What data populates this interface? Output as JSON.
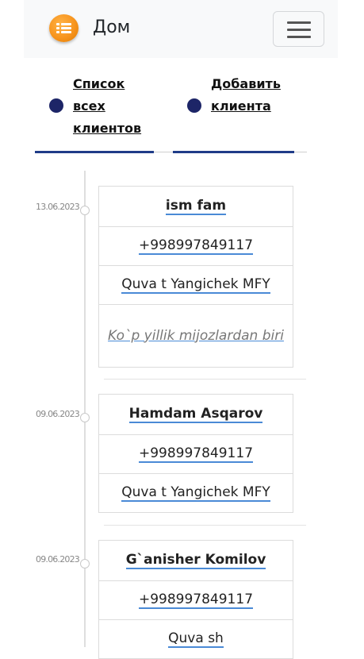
{
  "navbar": {
    "brand_icon": "list-icon",
    "title": "Дом",
    "toggler_icon": "hamburger-icon",
    "accent": "#f7941d"
  },
  "tabs": [
    {
      "label": "Список\nвсех\nклиентов",
      "active": true
    },
    {
      "label": "Добавить\nклиента",
      "active": true
    }
  ],
  "colors": {
    "tab_accent": "#1f3c88",
    "dot": "#1d2567",
    "link_underline": "#4a8ad6"
  },
  "clients": [
    {
      "date": "13.06.2023",
      "name": "ism fam",
      "phone": "+998997849117",
      "address": "Quva t Yangichek MFY",
      "note": "Ko`p yillik mijozlardan biri"
    },
    {
      "date": "09.06.2023",
      "name": "Hamdam Asqarov",
      "phone": "+998997849117",
      "address": "Quva t Yangichek MFY"
    },
    {
      "date": "09.06.2023",
      "name": "G`anisher Komilov",
      "phone": "+998997849117",
      "address": "Quva sh"
    }
  ]
}
